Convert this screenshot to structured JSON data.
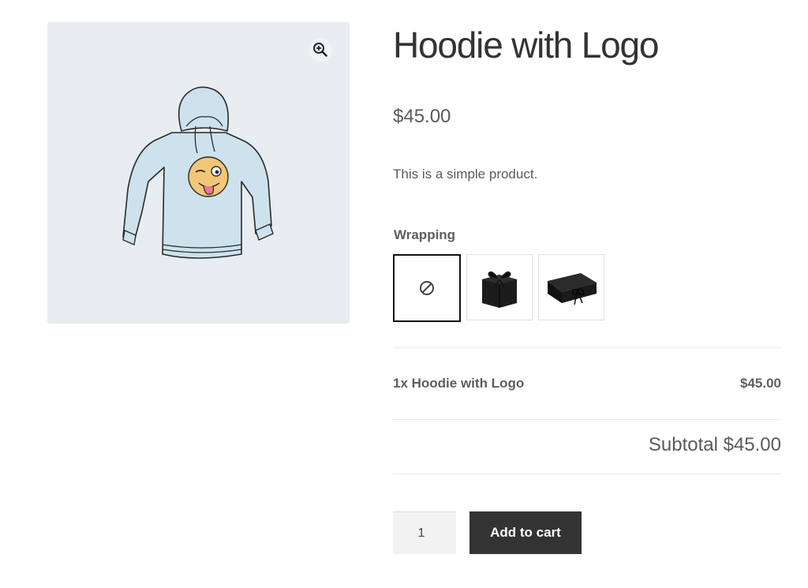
{
  "product": {
    "title": "Hoodie with Logo",
    "price": "$45.00",
    "description": "This is a simple product.",
    "image_icon": "hoodie-image",
    "zoom_icon": "zoom-in-icon"
  },
  "wrapping": {
    "label": "Wrapping",
    "options": [
      {
        "icon": "no-wrapping-icon",
        "selected": true
      },
      {
        "icon": "gift-box-icon",
        "selected": false
      },
      {
        "icon": "gift-box-ribbon-icon",
        "selected": false
      }
    ]
  },
  "summary": {
    "line_item": "1x Hoodie with Logo",
    "line_amount": "$45.00",
    "subtotal": "Subtotal $45.00"
  },
  "cart": {
    "quantity": "1",
    "add_label": "Add to cart"
  },
  "colors": {
    "button_bg": "#333333",
    "gallery_bg": "#e8edf1"
  }
}
